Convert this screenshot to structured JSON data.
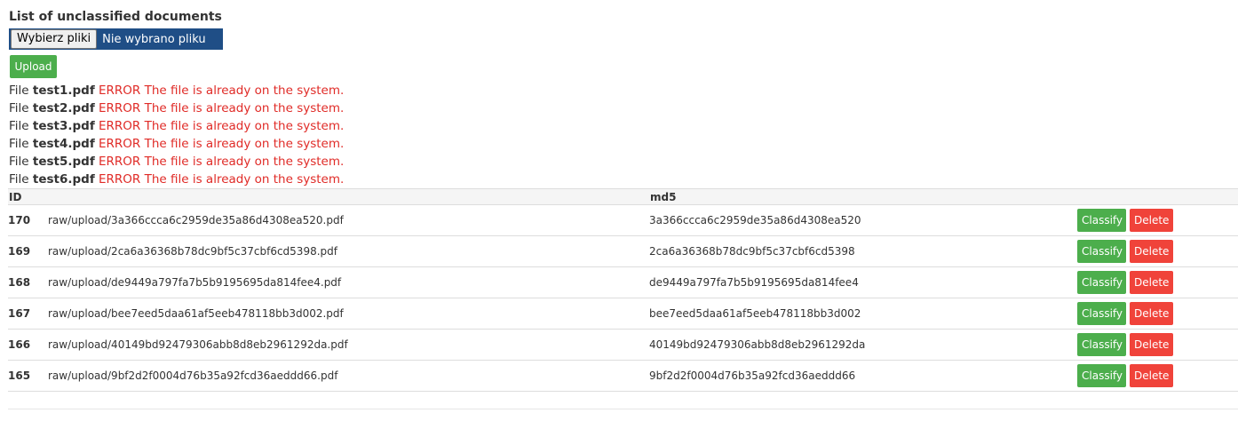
{
  "page": {
    "title": "List of unclassified documents"
  },
  "upload_form": {
    "choose_files_label": "Wybierz pliki",
    "no_file_text": "Nie wybrano pliku",
    "upload_label": "Upload"
  },
  "messages": [
    {
      "prefix": "File",
      "filename": "test1.pdf",
      "error": "ERROR The file is already on the system."
    },
    {
      "prefix": "File",
      "filename": "test2.pdf",
      "error": "ERROR The file is already on the system."
    },
    {
      "prefix": "File",
      "filename": "test3.pdf",
      "error": "ERROR The file is already on the system."
    },
    {
      "prefix": "File",
      "filename": "test4.pdf",
      "error": "ERROR The file is already on the system."
    },
    {
      "prefix": "File",
      "filename": "test5.pdf",
      "error": "ERROR The file is already on the system."
    },
    {
      "prefix": "File",
      "filename": "test6.pdf",
      "error": "ERROR The file is already on the system."
    }
  ],
  "table": {
    "headers": {
      "id": "ID",
      "path": "",
      "md5": "md5",
      "actions": ""
    },
    "rows": [
      {
        "id": "170",
        "path": "raw/upload/3a366ccca6c2959de35a86d4308ea520.pdf",
        "md5": "3a366ccca6c2959de35a86d4308ea520",
        "classify": "Classify",
        "delete": "Delete"
      },
      {
        "id": "169",
        "path": "raw/upload/2ca6a36368b78dc9bf5c37cbf6cd5398.pdf",
        "md5": "2ca6a36368b78dc9bf5c37cbf6cd5398",
        "classify": "Classify",
        "delete": "Delete"
      },
      {
        "id": "168",
        "path": "raw/upload/de9449a797fa7b5b9195695da814fee4.pdf",
        "md5": "de9449a797fa7b5b9195695da814fee4",
        "classify": "Classify",
        "delete": "Delete"
      },
      {
        "id": "167",
        "path": "raw/upload/bee7eed5daa61af5eeb478118bb3d002.pdf",
        "md5": "bee7eed5daa61af5eeb478118bb3d002",
        "classify": "Classify",
        "delete": "Delete"
      },
      {
        "id": "166",
        "path": "raw/upload/40149bd92479306abb8d8eb2961292da.pdf",
        "md5": "40149bd92479306abb8d8eb2961292da",
        "classify": "Classify",
        "delete": "Delete"
      },
      {
        "id": "165",
        "path": "raw/upload/9bf2d2f0004d76b35a92fcd36aeddd66.pdf",
        "md5": "9bf2d2f0004d76b35a92fcd36aeddd66",
        "classify": "Classify",
        "delete": "Delete"
      }
    ]
  },
  "colors": {
    "success": "#4cae4c",
    "danger": "#f0433a",
    "error_text": "#e02b27",
    "file_input_bg": "#1f4e86"
  }
}
